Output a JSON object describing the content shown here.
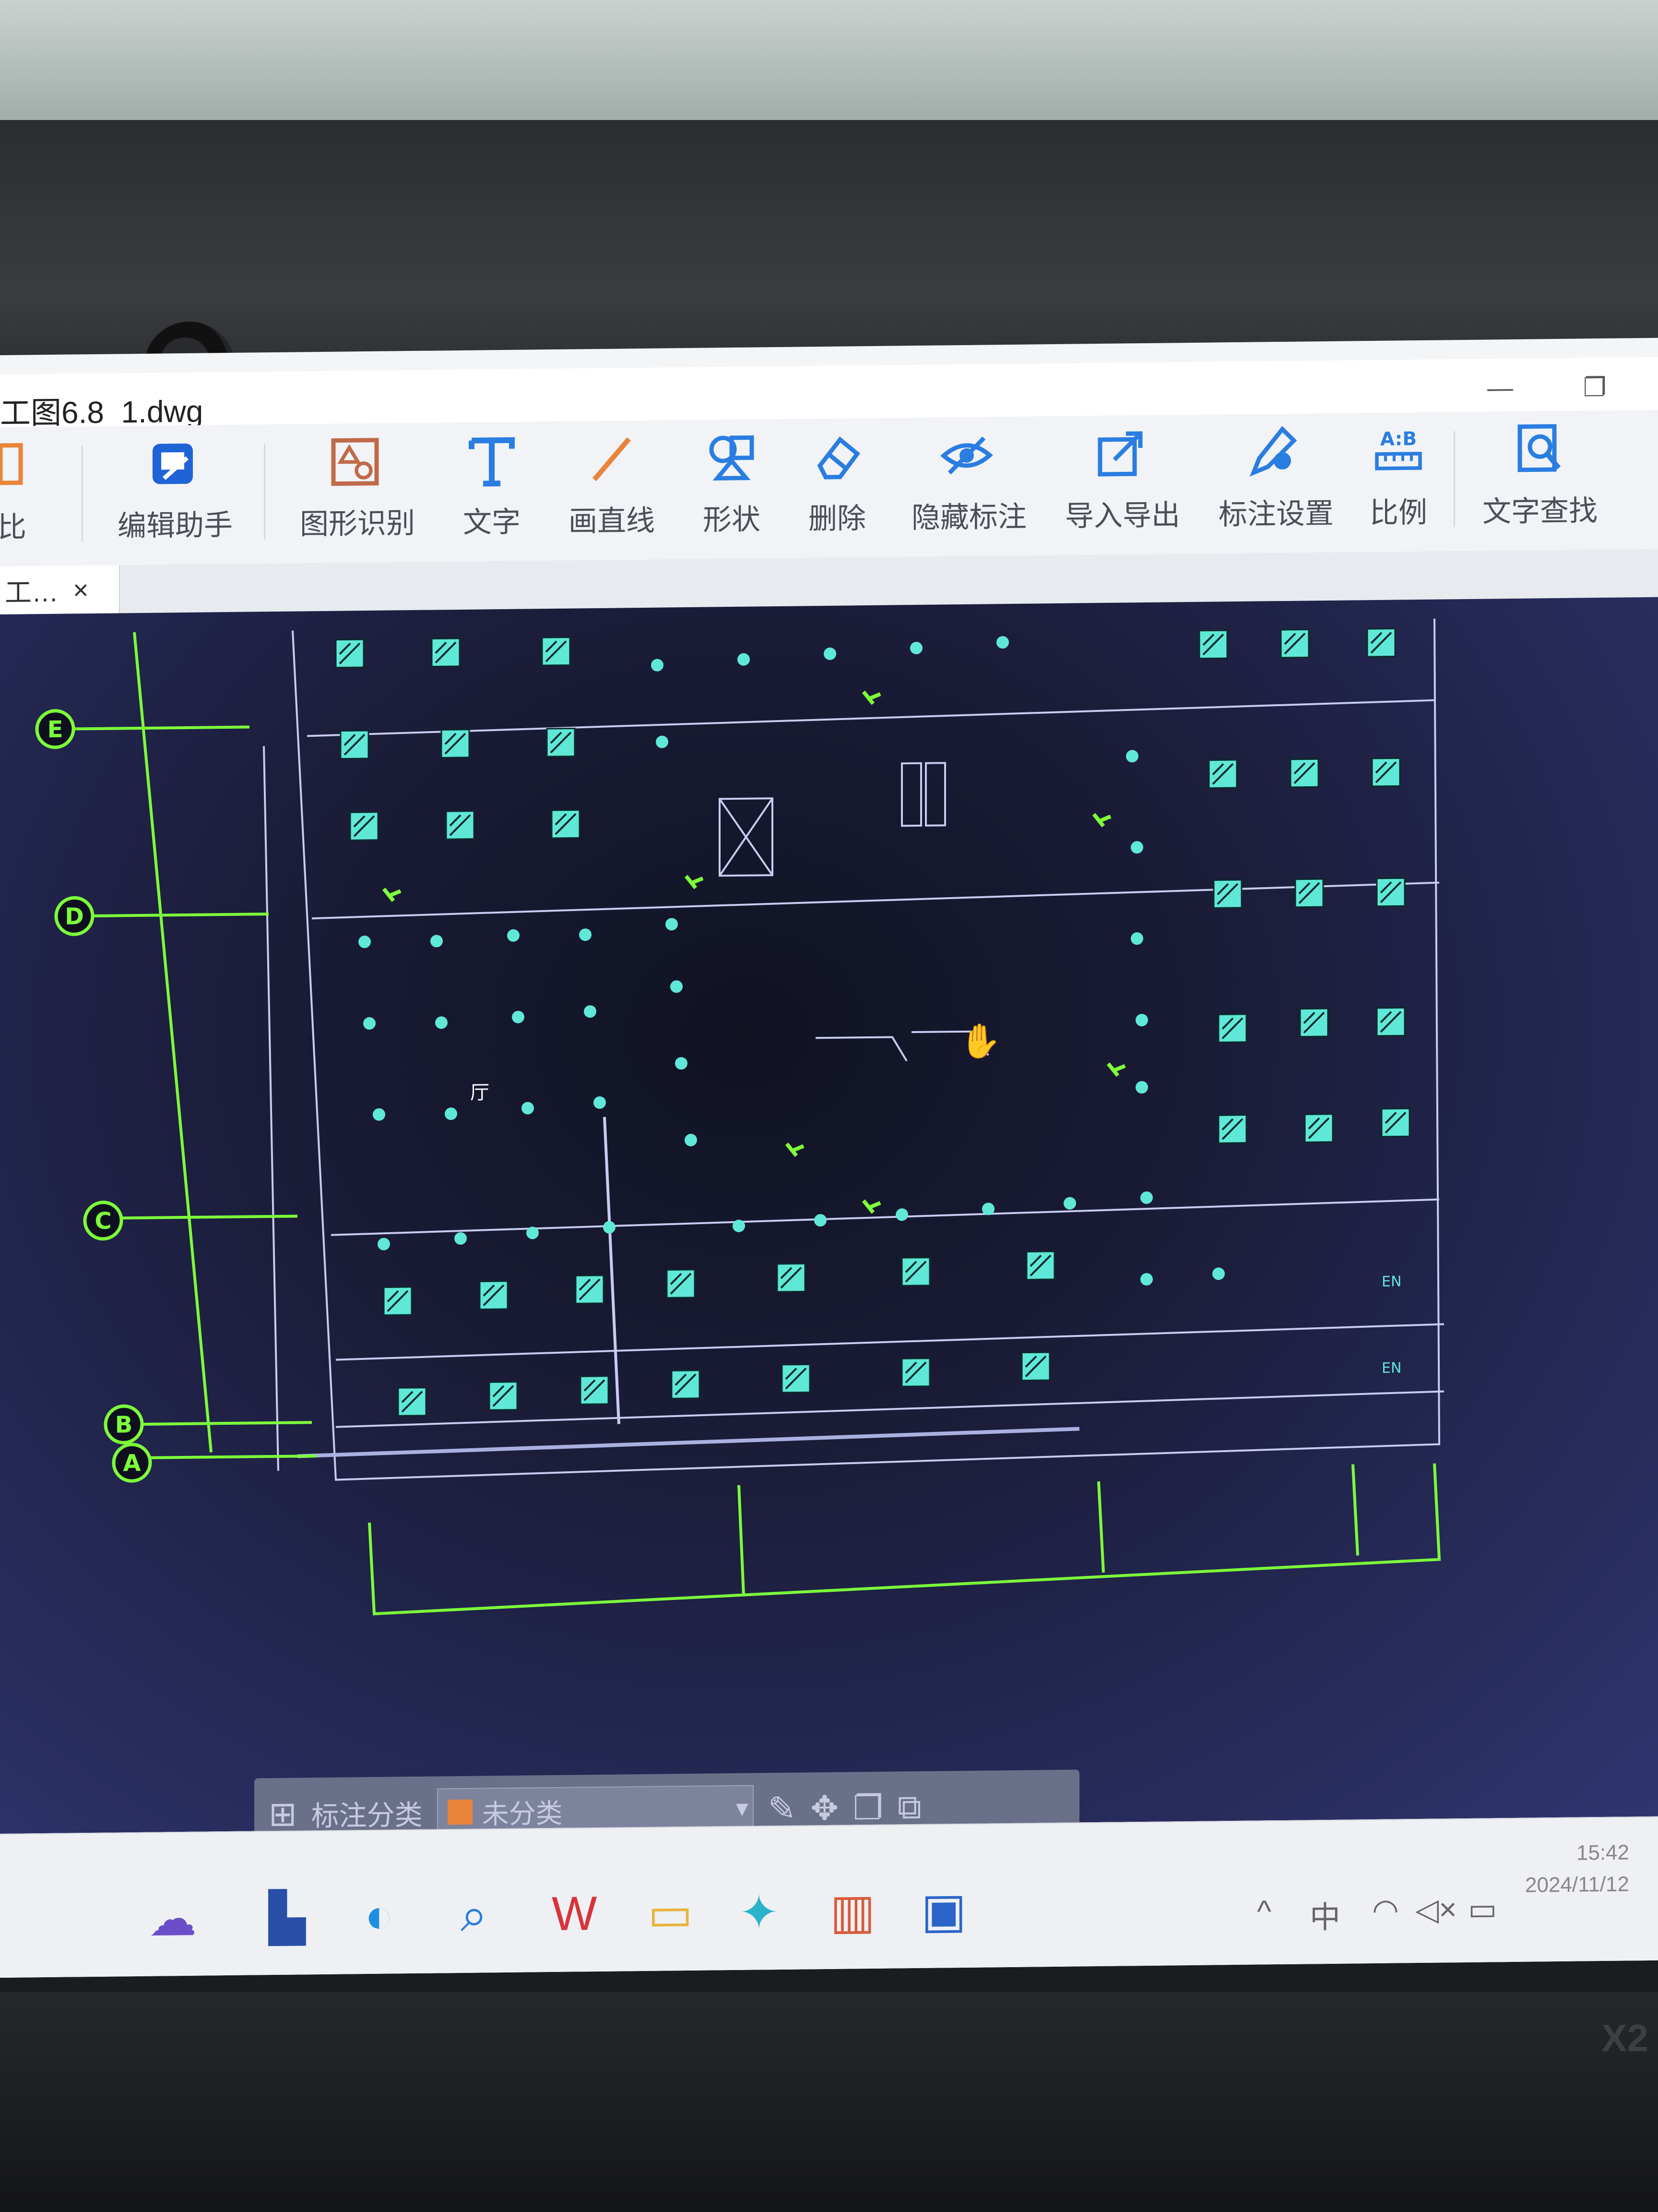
{
  "window": {
    "title": "工图6.8_1.dwg",
    "minimize": "—",
    "restore": "❐"
  },
  "ribbon": {
    "items": [
      {
        "label": "对比",
        "icon": "compare-icon"
      },
      {
        "label": "编辑助手",
        "icon": "edit-assistant-icon"
      },
      {
        "label": "图形识别",
        "icon": "shape-recognition-icon"
      },
      {
        "label": "文字",
        "icon": "text-icon"
      },
      {
        "label": "画直线",
        "icon": "line-icon"
      },
      {
        "label": "形状",
        "icon": "shape-icon"
      },
      {
        "label": "删除",
        "icon": "eraser-icon"
      },
      {
        "label": "隐藏标注",
        "icon": "hide-annotation-icon"
      },
      {
        "label": "导入导出",
        "icon": "import-export-icon"
      },
      {
        "label": "标注设置",
        "icon": "annotation-settings-icon"
      },
      {
        "label": "比例",
        "icon": "scale-icon"
      },
      {
        "label": "文字查找",
        "icon": "text-search-icon"
      }
    ],
    "scale_icon_text": "A:B"
  },
  "doc_tab": {
    "label": "工…",
    "close": "×"
  },
  "drawing": {
    "grid_labels": [
      "E",
      "D",
      "C",
      "B",
      "A"
    ],
    "room_label": "厅",
    "emergency_tag": "EN",
    "colors": {
      "lines": "#7dff3a",
      "fixtures": "#5fe8d8",
      "walls": "#c8ccf0"
    }
  },
  "annotation_bar": {
    "label": "标注分类",
    "category": "未分类",
    "swatch_color": "#e8853a"
  },
  "taskbar": {
    "tray_chevron": "^",
    "ime": "中",
    "time": "15:42",
    "date": "2024/11/12"
  },
  "device": {
    "brand": "X2"
  }
}
